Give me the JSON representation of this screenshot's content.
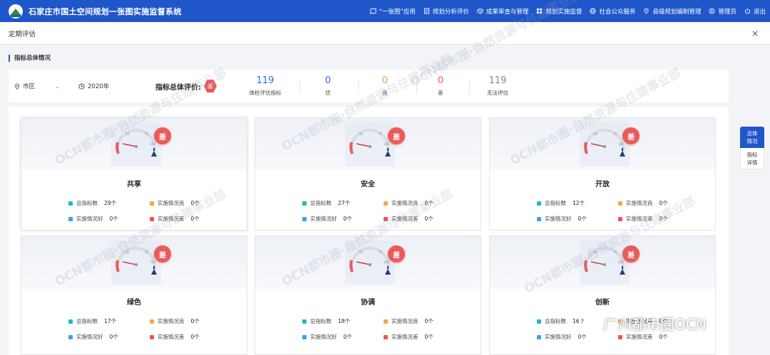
{
  "header": {
    "title": "石家庄市国土空间规划一张图实施监督系统",
    "nav": [
      {
        "label": "“一张图”应用",
        "icon": "map-icon"
      },
      {
        "label": "规划分析评价",
        "icon": "document-icon"
      },
      {
        "label": "成果审查与管理",
        "icon": "cube-icon"
      },
      {
        "label": "规划实施监督",
        "icon": "grid-icon"
      },
      {
        "label": "社会公众服务",
        "icon": "globe-icon"
      },
      {
        "label": "县级规划编制管理",
        "icon": "pin-icon"
      },
      {
        "label": "管理员",
        "icon": "user-icon"
      },
      {
        "label": "退出",
        "icon": "power-icon"
      }
    ]
  },
  "subheader": {
    "title": "定期评估",
    "close": "×"
  },
  "section": {
    "title": "指标总体情况"
  },
  "filters": {
    "region": "市区",
    "year": "2020年"
  },
  "overall": {
    "label": "指标总体评价:",
    "grade": "差",
    "stats": [
      {
        "value": "119",
        "label": "体检评估指标",
        "color": "#2a6fd6"
      },
      {
        "value": "0",
        "label": "优",
        "color": "#2a6fd6"
      },
      {
        "value": "0",
        "label": "良",
        "color": "#f0a040"
      },
      {
        "value": "0",
        "label": "差",
        "color": "#e85a5a"
      },
      {
        "value": "119",
        "label": "无法评估",
        "color": "#888888"
      }
    ]
  },
  "side_tabs": [
    {
      "label_1": "总体",
      "label_2": "情况"
    },
    {
      "label_1": "指标",
      "label_2": "详情"
    }
  ],
  "gauge_ticks": [
    "50",
    "75",
    "100"
  ],
  "metric_labels": {
    "total": "总指标数",
    "good_status": "实施情况良",
    "fine_status": "实施情况好",
    "poor_status": "实施情况差"
  },
  "metric_colors": {
    "total": "#22b8c8",
    "good_status": "#f4a64a",
    "fine_status": "#3aa5e8",
    "poor_status": "#f05454"
  },
  "cards": [
    {
      "name": "共享",
      "grade": "差",
      "total": "29个",
      "good": "0个",
      "fine": "0个",
      "poor": "0个"
    },
    {
      "name": "安全",
      "grade": "差",
      "total": "27个",
      "good": "0个",
      "fine": "0个",
      "poor": "0个"
    },
    {
      "name": "开放",
      "grade": "差",
      "total": "12个",
      "good": "0个",
      "fine": "0个",
      "poor": "0个"
    },
    {
      "name": "绿色",
      "grade": "差",
      "total": "17个",
      "good": "0个",
      "fine": "0个",
      "poor": "0个"
    },
    {
      "name": "协调",
      "grade": "差",
      "total": "18个",
      "good": "0个",
      "fine": "0个",
      "poor": "0个"
    },
    {
      "name": "创新",
      "grade": "差",
      "total": "16个",
      "good": "0个",
      "fine": "0个",
      "poor": "0个"
    }
  ],
  "watermark": {
    "text": "OCN都市圈·自然资源与住建事业部",
    "brand": "广州都市圈OCN"
  }
}
